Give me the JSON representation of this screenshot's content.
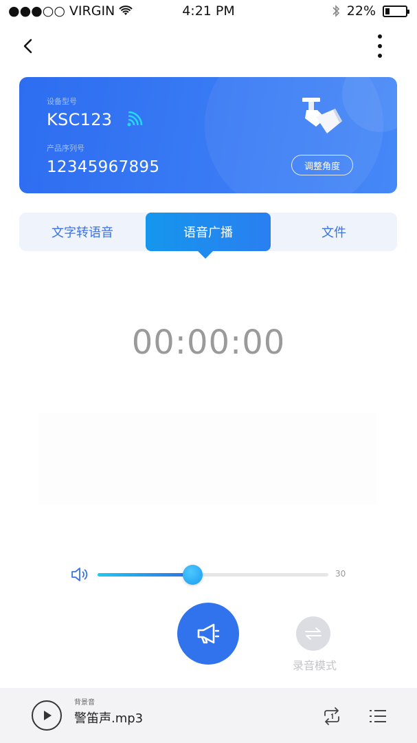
{
  "status_bar": {
    "carrier": "●●●○○ VIRGIN",
    "time": "4:21 PM",
    "battery_text": "22%",
    "battery_level": 0.22
  },
  "device": {
    "model_label": "设备型号",
    "model_value": "KSC123",
    "serial_label": "产品序列号",
    "serial_value": "12345967895",
    "adjust_button": "调整角度"
  },
  "tabs": [
    {
      "label": "文字转语音",
      "active": false
    },
    {
      "label": "语音广播",
      "active": true
    },
    {
      "label": "文件",
      "active": false
    }
  ],
  "timer": "00:00:00",
  "volume": {
    "max_label": "30",
    "level_fraction": 0.41
  },
  "record_mode_label": "录音模式",
  "player": {
    "bg_label": "背景音",
    "track": "警笛声.mp3"
  },
  "colors": {
    "accent": "#3173ec",
    "card": "#3b7cf5",
    "tab_active": "#1f8bef",
    "timer": "#9a9a9a"
  }
}
